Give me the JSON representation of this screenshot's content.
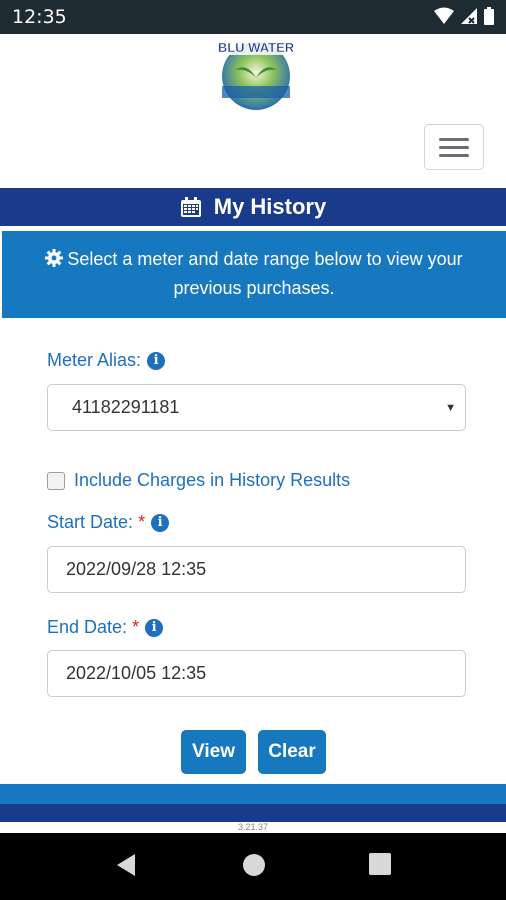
{
  "status_bar": {
    "time": "12:35"
  },
  "app": {
    "logo_text": "BLU WATER"
  },
  "header": {
    "menu_icon": "hamburger-icon"
  },
  "page": {
    "title": "My History",
    "title_icon": "calendar-icon"
  },
  "notice": {
    "icon": "gear-icon",
    "text": "Select a meter and date range below to view your previous purchases."
  },
  "form": {
    "meter_alias_label": "Meter Alias:",
    "meter_alias_value": "41182291181",
    "include_charges_label": "Include Charges in History Results",
    "include_charges_checked": false,
    "start_date_label": "Start Date:",
    "start_date_value": "2022/09/28 12:35",
    "end_date_label": "End Date:",
    "end_date_value": "2022/10/05 12:35",
    "required_mark": "*",
    "info_icon": "info-icon"
  },
  "actions": {
    "view_label": "View",
    "clear_label": "Clear"
  },
  "footer": {
    "version": "3.21.37"
  },
  "colors": {
    "navy": "#1a3a8c",
    "blue": "#1679bf",
    "label": "#1d6fc0",
    "required": "#e02020"
  }
}
